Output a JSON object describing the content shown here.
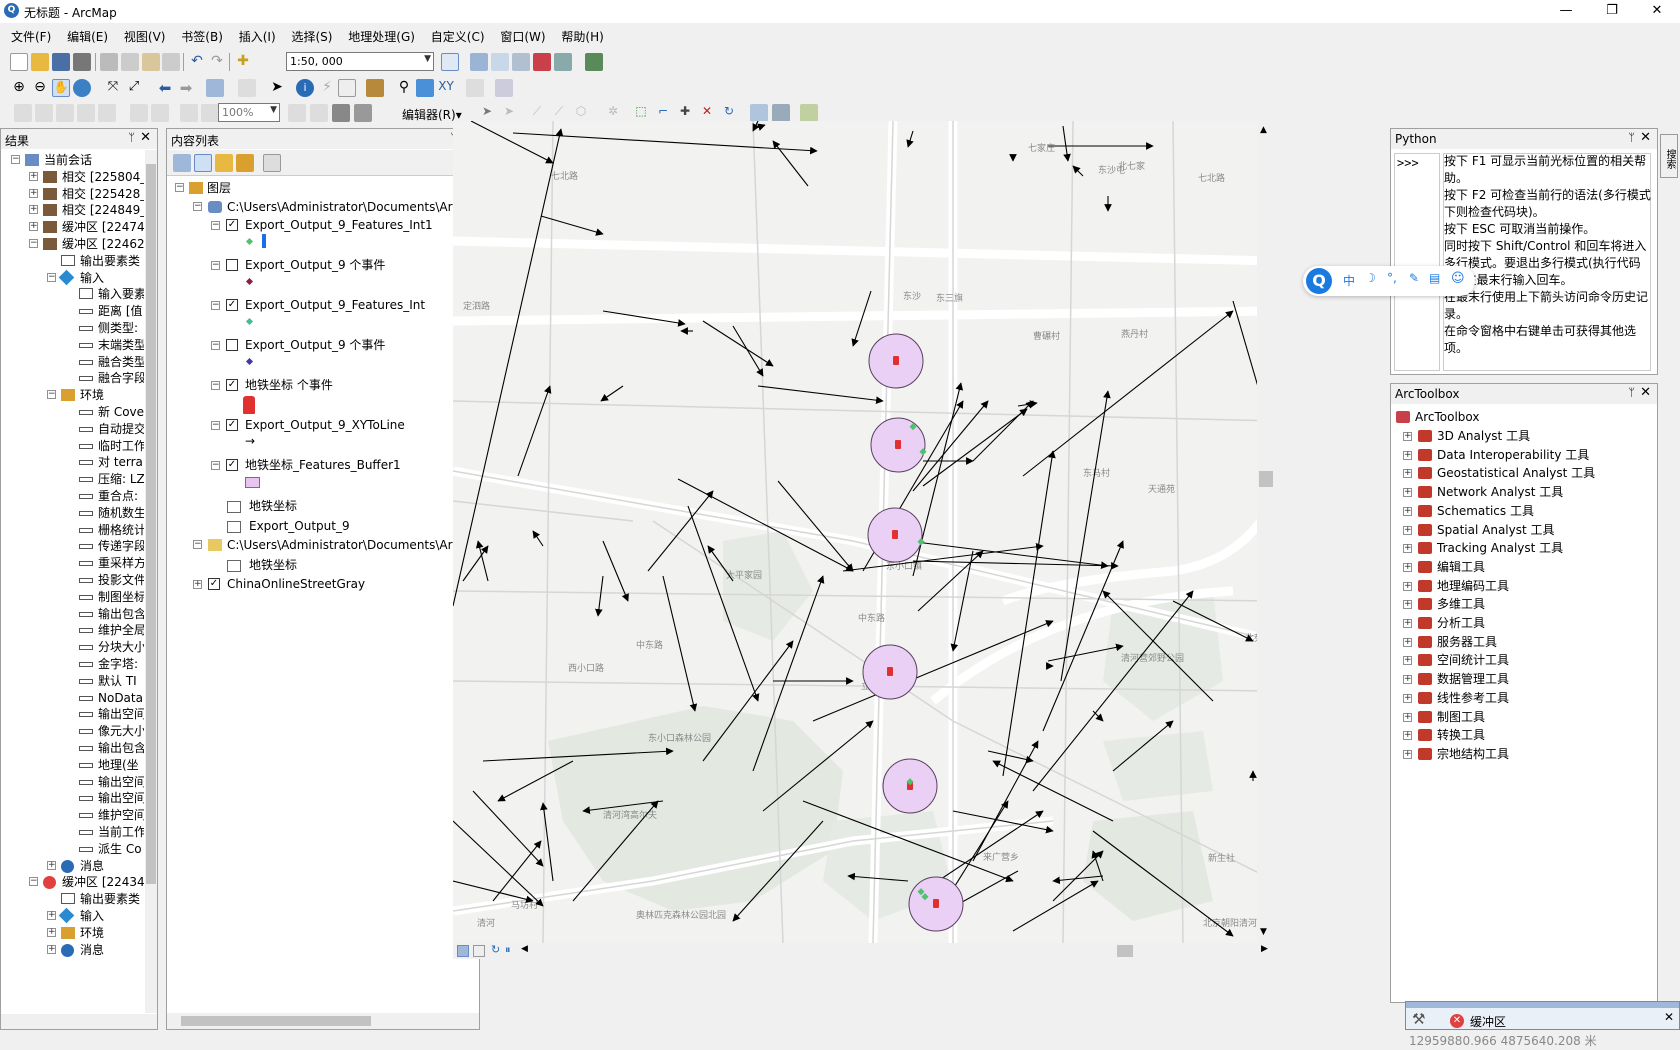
{
  "window": {
    "title": "无标题 - ArcMap",
    "app_icon": "arcmap-globe-icon",
    "minimize": "—",
    "maximize": "❐",
    "close": "✕"
  },
  "menu": [
    "文件(F)",
    "编辑(E)",
    "视图(V)",
    "书签(B)",
    "插入(I)",
    "选择(S)",
    "地理处理(G)",
    "自定义(C)",
    "窗口(W)",
    "帮助(H)"
  ],
  "toolbar": {
    "scale": "1:50, 000",
    "zoom_percent": "100%",
    "editor_label": "编辑器(R)▾"
  },
  "results_panel": {
    "title": "结果",
    "items": [
      {
        "label": "当前会话"
      },
      {
        "label": "相交 [225804_"
      },
      {
        "label": "相交 [225428_"
      },
      {
        "label": "相交 [224849_"
      },
      {
        "label": "缓冲区 [22474"
      },
      {
        "label": "缓冲区 [22462"
      },
      {
        "label": "输出要素类"
      },
      {
        "label": "输入"
      },
      {
        "label": "输入要素"
      },
      {
        "label": "距离 [值"
      },
      {
        "label": "侧类型:"
      },
      {
        "label": "末端类型"
      },
      {
        "label": "融合类型"
      },
      {
        "label": "融合字段"
      },
      {
        "label": "环境"
      },
      {
        "label": "新 Cove"
      },
      {
        "label": "自动提交"
      },
      {
        "label": "临时工作"
      },
      {
        "label": "对 terra"
      },
      {
        "label": "压缩: LZ"
      },
      {
        "label": "重合点:"
      },
      {
        "label": "随机数生"
      },
      {
        "label": "栅格统计"
      },
      {
        "label": "传递字段"
      },
      {
        "label": "重采样方"
      },
      {
        "label": "投影文件"
      },
      {
        "label": "制图坐标"
      },
      {
        "label": "输出包含"
      },
      {
        "label": "维护全局"
      },
      {
        "label": "分块大小"
      },
      {
        "label": "金字塔:"
      },
      {
        "label": "默认 TI"
      },
      {
        "label": "NoData"
      },
      {
        "label": "输出空间"
      },
      {
        "label": "像元大小"
      },
      {
        "label": "输出包含"
      },
      {
        "label": "地理(坐"
      },
      {
        "label": "输出空间"
      },
      {
        "label": "输出空间"
      },
      {
        "label": "维护空间"
      },
      {
        "label": "当前工作"
      },
      {
        "label": "派生 Co"
      },
      {
        "label": "消息"
      },
      {
        "label": "缓冲区 [22434"
      },
      {
        "label": "输出要素类"
      },
      {
        "label": "输入"
      },
      {
        "label": "环境"
      },
      {
        "label": "消息"
      }
    ]
  },
  "toc_panel": {
    "title": "内容列表",
    "root": "图层",
    "group1": "C:\\Users\\Administrator\\Documents\\ArcGIS",
    "layers": [
      {
        "label": "Export_Output_9_Features_Int1",
        "checked": true
      },
      {
        "label": "Export_Output_9 个事件",
        "checked": false
      },
      {
        "label": "Export_Output_9_Features_Int",
        "checked": true
      },
      {
        "label": "Export_Output_9 个事件",
        "checked": false
      },
      {
        "label": "地铁坐标 个事件",
        "checked": true
      },
      {
        "label": "Export_Output_9_XYToLine",
        "checked": true
      },
      {
        "label": "地铁坐标_Features_Buffer1",
        "checked": true
      }
    ],
    "tables": [
      "地铁坐标",
      "Export_Output_9"
    ],
    "group2": "C:\\Users\\Administrator\\Documents\\ArcGIS",
    "group2_table": "地铁坐标",
    "basemap": "ChinaOnlineStreetGray"
  },
  "map": {
    "place_labels": [
      "七家庄",
      "东沙屯",
      "北七家",
      "七北路",
      "七北路",
      "定泗路",
      "东三旗",
      "东沙",
      "曹碾村",
      "燕丹村",
      "东马村",
      "天通苑",
      "东小口镇",
      "太平家园",
      "中东路",
      "中东路",
      "清河营郊野公园",
      "东小口森林公园",
      "清河湾高尔夫",
      "奥林匹克森林公园北园",
      "北京朝阳清河湾公园",
      "新生社",
      "来广营乡",
      "立水桥",
      "西小口路",
      "马坊村",
      "清河",
      "北苑路"
    ]
  },
  "python_panel": {
    "title": "Python",
    "prompt": ">>>",
    "help_lines": [
      "按下 F1 可显示当前光标位置的相关帮助。",
      "按下 F2 可检查当前行的语法(多行模式下则检查代码块)。",
      "按下 ESC 可取消当前操作。",
      "同时按下 Shift/Control 和回车将进入多行模式。要退出多行模式(执行代码块),在最末行输入回车。",
      "在最末行使用上下箭头访问命令历史记录。",
      "在命令窗格中右键单击可获得其他选项。"
    ]
  },
  "toolbox_panel": {
    "title": "ArcToolbox",
    "root": "ArcToolbox",
    "items": [
      "3D Analyst 工具",
      "Data Interoperability 工具",
      "Geostatistical Analyst 工具",
      "Network Analyst 工具",
      "Schematics 工具",
      "Spatial Analyst 工具",
      "Tracking Analyst 工具",
      "编辑工具",
      "地理编码工具",
      "多维工具",
      "分析工具",
      "服务器工具",
      "空间统计工具",
      "数据管理工具",
      "线性参考工具",
      "制图工具",
      "转换工具",
      "宗地结构工具"
    ]
  },
  "ime_bar": {
    "items": [
      "中",
      "☽",
      "°,",
      "✎",
      "▤",
      "☺"
    ]
  },
  "progress_popup": {
    "label": "缓冲区",
    "close": "✕"
  },
  "statusbar": {
    "coords": "12959880.966  4875640.208 米"
  },
  "side_tab": "搜索"
}
